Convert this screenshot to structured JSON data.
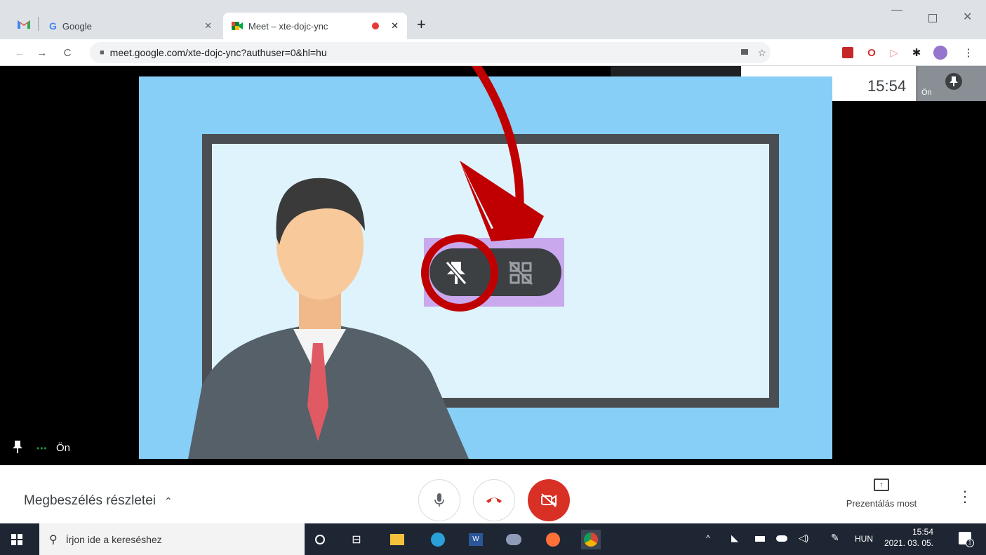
{
  "browser": {
    "tabs": [
      {
        "label": "Google",
        "icon": "google-icon"
      },
      {
        "label": "Meet – xte-dojc-ync",
        "icon": "meet-icon",
        "recording": true
      }
    ],
    "new_tab": "+",
    "address": "meet.google.com/xte-dojc-ync?authuser=0&hl=hu",
    "window_controls": [
      "minimize",
      "maximize",
      "close"
    ]
  },
  "meet": {
    "time": "15:54",
    "self_label": "Ön",
    "tile_self_label": "Ön",
    "tile_dots": "•••",
    "details_label": "Megbeszélés részletei",
    "present_label": "Prezentálás most",
    "accent_red": "#d93025"
  },
  "taskbar": {
    "search_placeholder": "Írjon ide a kereséshez",
    "language": "HUN",
    "clock_time": "15:54",
    "clock_date": "2021. 03. 05.",
    "notification_count": "1"
  },
  "annotation": {
    "arrow_color": "#c00000"
  }
}
